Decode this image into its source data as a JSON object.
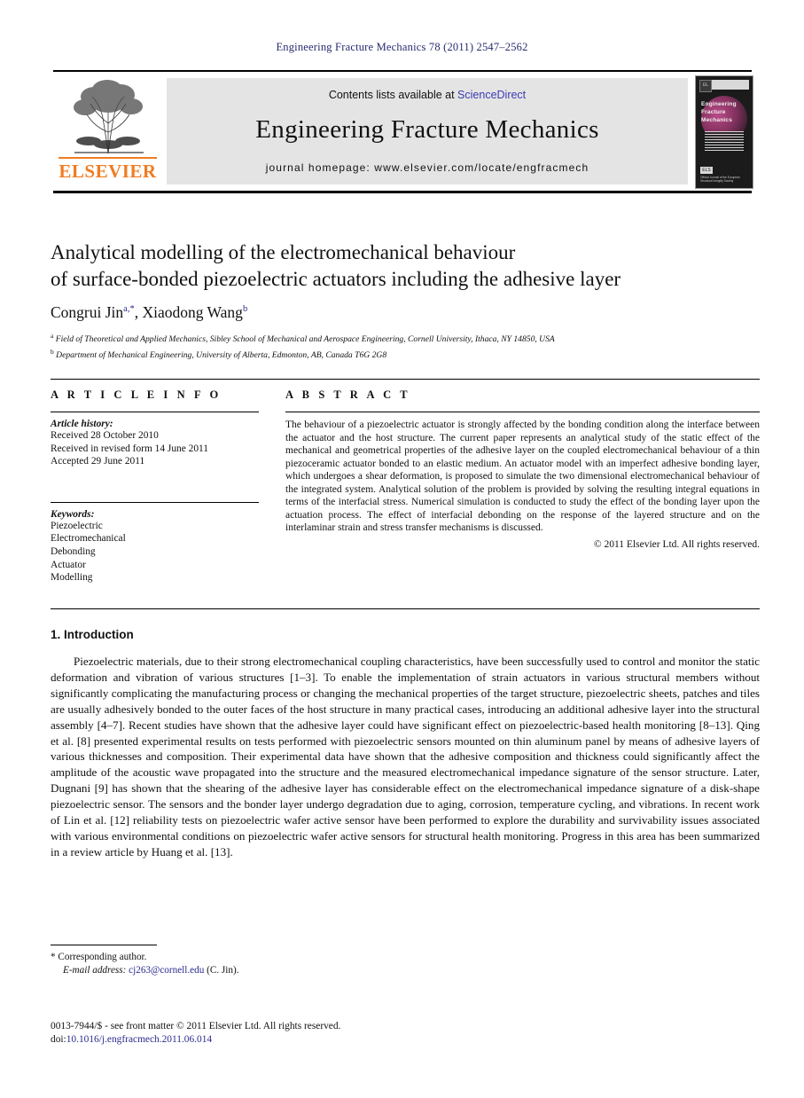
{
  "running_head": "Engineering Fracture Mechanics 78 (2011) 2547–2562",
  "masthead": {
    "contents_prefix": "Contents lists available at ",
    "sciencedirect": "ScienceDirect",
    "journal_title": "Engineering Fracture Mechanics",
    "homepage": "journal homepage: www.elsevier.com/locate/engfracmech",
    "publisher_logo_text": "ELSEVIER",
    "cover": {
      "journal_name_line1": "Engineering",
      "journal_name_line2": "Fracture Mechanics",
      "badge": "EL",
      "foot_logo": "ELS",
      "foot_text": "Official Journal of the European Structural Integrity Society"
    },
    "accent_link_color": "#3b3bb5"
  },
  "article": {
    "title_line1": "Analytical modelling of the electromechanical behaviour",
    "title_line2": "of surface-bonded piezoelectric actuators including the adhesive layer",
    "authors": [
      {
        "name": "Congrui Jin",
        "marks": "a,*"
      },
      {
        "name": "Xiaodong Wang",
        "marks": "b"
      }
    ],
    "affiliations": [
      {
        "mark": "a",
        "text": "Field of Theoretical and Applied Mechanics, Sibley School of Mechanical and Aerospace Engineering, Cornell University, Ithaca, NY 14850, USA"
      },
      {
        "mark": "b",
        "text": "Department of Mechanical Engineering, University of Alberta, Edmonton, AB, Canada T6G 2G8"
      }
    ]
  },
  "article_info": {
    "heading": "A R T I C L E    I N F O",
    "history_label": "Article history:",
    "history": [
      "Received 28 October 2010",
      "Received in revised form 14 June 2011",
      "Accepted 29 June 2011"
    ],
    "keywords_label": "Keywords:",
    "keywords": [
      "Piezoelectric",
      "Electromechanical",
      "Debonding",
      "Actuator",
      "Modelling"
    ]
  },
  "abstract": {
    "heading": "A B S T R A C T",
    "text": "The behaviour of a piezoelectric actuator is strongly affected by the bonding condition along the interface between the actuator and the host structure. The current paper represents an analytical study of the static effect of the mechanical and geometrical properties of the adhesive layer on the coupled electromechanical behaviour of a thin piezoceramic actuator bonded to an elastic medium. An actuator model with an imperfect adhesive bonding layer, which undergoes a shear deformation, is proposed to simulate the two dimensional electromechanical behaviour of the integrated system. Analytical solution of the problem is provided by solving the resulting integral equations in terms of the interfacial stress. Numerical simulation is conducted to study the effect of the bonding layer upon the actuation process. The effect of interfacial debonding on the response of the layered structure and on the interlaminar strain and stress transfer mechanisms is discussed.",
    "copyright": "© 2011 Elsevier Ltd. All rights reserved."
  },
  "body": {
    "section_number_title": "1. Introduction",
    "paragraph_1": "Piezoelectric materials, due to their strong electromechanical coupling characteristics, have been successfully used to control and monitor the static deformation and vibration of various structures [1–3]. To enable the implementation of strain actuators in various structural members without significantly complicating the manufacturing process or changing the mechanical properties of the target structure, piezoelectric sheets, patches and tiles are usually adhesively bonded to the outer faces of the host structure in many practical cases, introducing an additional adhesive layer into the structural assembly [4–7]. Recent studies have shown that the adhesive layer could have significant effect on piezoelectric-based health monitoring [8–13]. Qing et al. [8] presented experimental results on tests performed with piezoelectric sensors mounted on thin aluminum panel by means of adhesive layers of various thicknesses and composition. Their experimental data have shown that the adhesive composition and thickness could significantly affect the amplitude of the acoustic wave propagated into the structure and the measured electromechanical impedance signature of the sensor structure. Later, Dugnani [9] has shown that the shearing of the adhesive layer has considerable effect on the electromechanical impedance signature of a disk-shape piezoelectric sensor. The sensors and the bonder layer undergo degradation due to aging, corrosion, temperature cycling, and vibrations. In recent work of Lin et al. [12] reliability tests on piezoelectric wafer active sensor have been performed to explore the durability and survivability issues associated with various environmental conditions on piezoelectric wafer active sensors for structural health monitoring. Progress in this area has been summarized in a review article by Huang et al. [13]."
  },
  "footer": {
    "corresponding": "* Corresponding author.",
    "email_label": "E-mail address:",
    "email_address": "cj263@cornell.edu",
    "email_suffix": "(C. Jin).",
    "imprint_line": "0013-7944/$ - see front matter © 2011 Elsevier Ltd. All rights reserved.",
    "doi_label": "doi:",
    "doi_value": "10.1016/j.engfracmech.2011.06.014"
  }
}
